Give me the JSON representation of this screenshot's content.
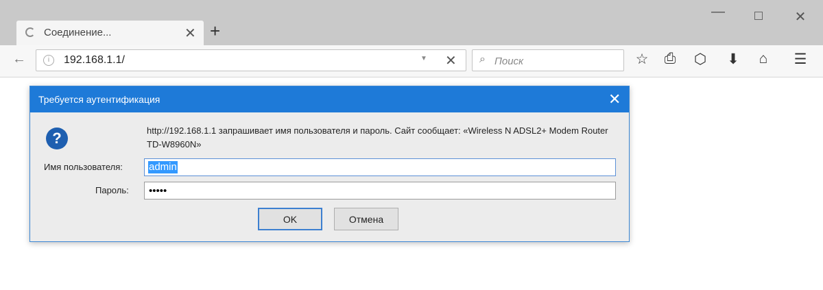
{
  "browser": {
    "tab_title": "Соединение...",
    "tab_close": "✕",
    "new_tab": "+",
    "window_min": "—",
    "window_close": "✕"
  },
  "navbar": {
    "url": "192.168.1.1/",
    "search_placeholder": "Поиск",
    "stop": "✕"
  },
  "dialog": {
    "title": "Требуется аутентификация",
    "close": "✕",
    "message": "http://192.168.1.1 запрашивает имя пользователя и пароль. Сайт сообщает: «Wireless N ADSL2+ Modem Router TD-W8960N»",
    "username_label": "Имя пользователя:",
    "username_value": "admin",
    "password_label": "Пароль:",
    "password_value": "•••••",
    "ok_label": "OK",
    "cancel_label": "Отмена"
  },
  "colors": {
    "accent": "#1e7ad8",
    "selection": "#3399ff"
  },
  "icons": [
    "loading-spinner-icon",
    "back-arrow-icon",
    "info-icon",
    "dropdown-icon",
    "search-icon",
    "star-icon",
    "clipboard-icon",
    "pocket-icon",
    "download-icon",
    "home-icon",
    "menu-icon",
    "question-icon"
  ]
}
